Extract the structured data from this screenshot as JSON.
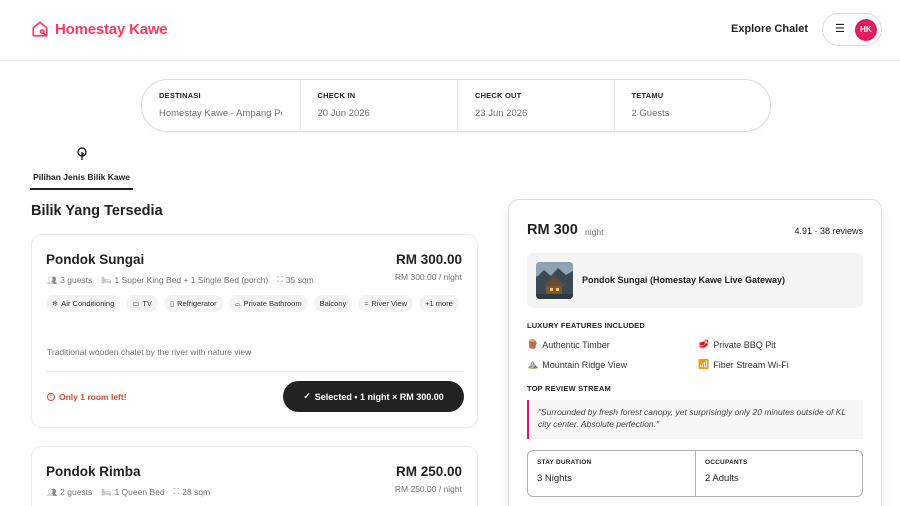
{
  "header": {
    "logo_text": "Homestay Kawe",
    "explore_label": "Explore Chalet",
    "avatar_initials": "HK",
    "brand_color": "#ff385c"
  },
  "search": {
    "destination_label": "DESTINASI",
    "destination_value": "Homestay Kawe - Ampang Pecah",
    "checkin_label": "CHECK IN",
    "checkin_value": "20 Jun 2026",
    "checkout_label": "CHECK OUT",
    "checkout_value": "23 Jun 2026",
    "guests_label": "TETAMU",
    "guests_value": "2 Guests"
  },
  "tab": {
    "label": "Pilihan Jenis Bilik Kawe",
    "icon": "tree-icon"
  },
  "section_title": "Bilik Yang Tersedia",
  "rooms": [
    {
      "name": "Pondok Sungai",
      "price": "RM 300.00",
      "price_sub": "RM 300.00 / night",
      "guests": "3 guests",
      "beds": "1 Super King Bed + 1 Single Bed (porch)",
      "size": "35 sqm",
      "amenities": [
        "Air Conditioning",
        "TV",
        "Refrigerator",
        "Private Bathroom",
        "Balcony",
        "River View"
      ],
      "more": "+1 more",
      "description": "Traditional wooden chalet by the river with nature view",
      "warning": "Only 1 room left!",
      "button": "Selected • 1 night × RM 300.00"
    },
    {
      "name": "Pondok Rimba",
      "price": "RM 250.00",
      "price_sub": "RM 250.00 / night",
      "guests": "2 guests",
      "beds": "1 Queen Bed",
      "size": "28 sqm"
    }
  ],
  "panel": {
    "price": "RM 300",
    "per": "night",
    "rating": "4.91 · 38 reviews",
    "listing_name": "Pondok Sungai (Homestay Kawe Live Gateway)",
    "features_heading": "LUXURY FEATURES INCLUDED",
    "features": [
      {
        "icon": "timber-icon",
        "glyph": "🪵",
        "label": "Authentic Timber"
      },
      {
        "icon": "bbq-icon",
        "glyph": "🥩",
        "label": "Private BBQ Pit"
      },
      {
        "icon": "mountain-icon",
        "glyph": "⛰️",
        "label": "Mountain Ridge View"
      },
      {
        "icon": "wifi-icon",
        "glyph": "📶",
        "label": "Fiber Stream Wi-Fi"
      }
    ],
    "review_heading": "TOP REVIEW STREAM",
    "review_text": "\"Surrounded by fresh forest canopy, yet surprisingly only 20 minutes outside of KL city center. Absolute perfection.\"",
    "stay_label": "STAY DURATION",
    "stay_value": "3 Nights",
    "occupants_label": "OCCUPANTS",
    "occupants_value": "2 Adults"
  }
}
